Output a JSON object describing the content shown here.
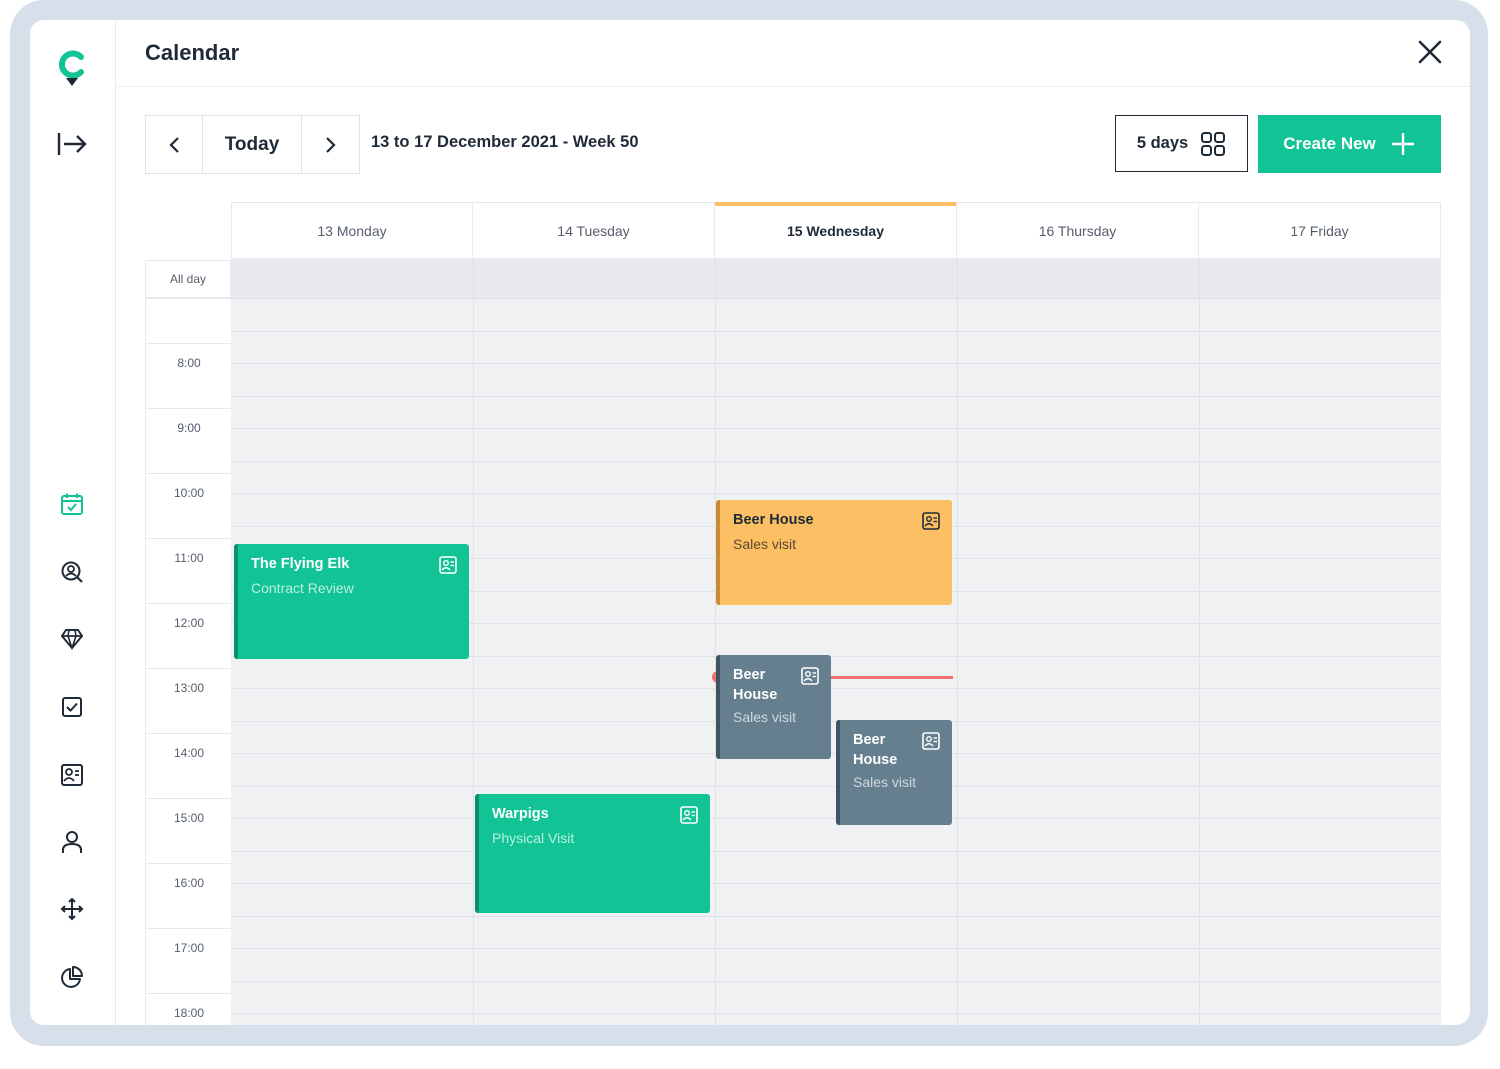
{
  "header": {
    "title": "Calendar"
  },
  "toolbar": {
    "today_label": "Today",
    "date_range": "13 to 17 December 2021 - Week 50",
    "view_label": "5 days",
    "create_label": "Create New"
  },
  "calendar": {
    "all_day_label": "All day",
    "days": [
      "13 Monday",
      "14 Tuesday",
      "15 Wednesday",
      "16 Thursday",
      "17 Friday"
    ],
    "active_day": "15 Wednesday",
    "hours": [
      "8:00",
      "9:00",
      "10:00",
      "11:00",
      "12:00",
      "13:00",
      "14:00",
      "15:00",
      "16:00",
      "17:00",
      "18:00"
    ],
    "events": [
      {
        "title": "The Flying Elk",
        "subtitle": "Contract Review",
        "day": "13 Monday",
        "start": "11:00",
        "end": "12:45",
        "color": "#12c396"
      },
      {
        "title": "Warpigs",
        "subtitle": "Physical Visit",
        "day": "14 Tuesday",
        "start": "15:00",
        "end": "16:50",
        "color": "#12c396"
      },
      {
        "title": "Beer House",
        "subtitle": "Sales visit",
        "day": "15 Wednesday",
        "start": "10:30",
        "end": "12:05",
        "color": "#fdbf63"
      },
      {
        "title": "Beer House",
        "subtitle": "Sales visit",
        "day": "15 Wednesday",
        "start": "12:50",
        "end": "14:25",
        "color": "#657f8e"
      },
      {
        "title": "Beer House",
        "subtitle": "Sales visit",
        "day": "15 Wednesday",
        "start": "13:50",
        "end": "15:25",
        "color": "#657f8e"
      }
    ],
    "current_time_marker_color": "#f0716f"
  },
  "colors": {
    "accent": "#12c396",
    "active_day_bar": "#fdbf63"
  },
  "sidebar": {
    "icons": [
      "logo-icon",
      "collapse-icon",
      "calendar-icon",
      "search-user-icon",
      "diamond-icon",
      "checkbox-icon",
      "contacts-card-icon",
      "user-icon",
      "move-icon",
      "pie-chart-icon"
    ]
  }
}
